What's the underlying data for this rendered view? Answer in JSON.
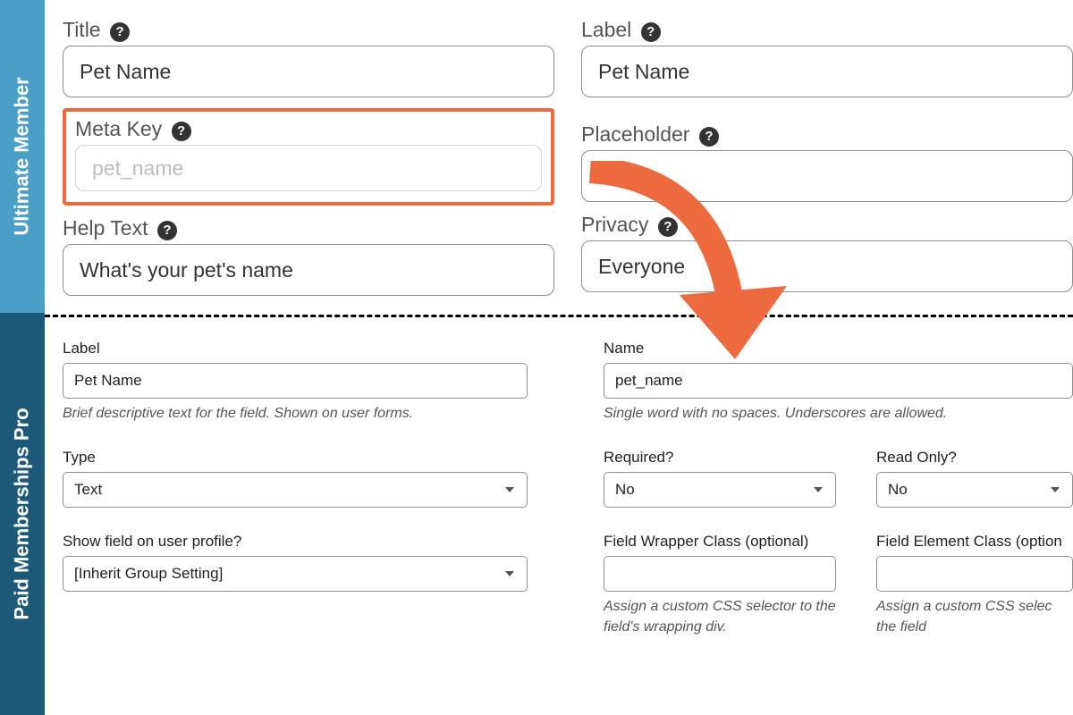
{
  "sidebar": {
    "top": "Ultimate Member",
    "bottom": "Paid Memberships Pro"
  },
  "um": {
    "title": {
      "label": "Title",
      "value": "Pet Name"
    },
    "metaKey": {
      "label": "Meta Key",
      "placeholder": "pet_name"
    },
    "helpText": {
      "label": "Help Text",
      "value": "What's your pet's name"
    },
    "labelField": {
      "label": "Label",
      "value": "Pet Name"
    },
    "placeholder": {
      "label": "Placeholder",
      "value": ""
    },
    "privacy": {
      "label": "Privacy",
      "value": "Everyone"
    }
  },
  "pm": {
    "labelField": {
      "label": "Label",
      "value": "Pet Name",
      "desc": "Brief descriptive text for the field. Shown on user forms."
    },
    "name": {
      "label": "Name",
      "value": "pet_name",
      "desc": "Single word with no spaces. Underscores are allowed."
    },
    "type": {
      "label": "Type",
      "value": "Text"
    },
    "required": {
      "label": "Required?",
      "value": "No"
    },
    "readOnly": {
      "label": "Read Only?",
      "value": "No"
    },
    "showProfile": {
      "label": "Show field on user profile?",
      "value": "[Inherit Group Setting]"
    },
    "wrapperClass": {
      "label": "Field Wrapper Class (optional)",
      "value": "",
      "desc": "Assign a custom CSS selector to the field's wrapping div."
    },
    "elementClass": {
      "label": "Field Element Class (option",
      "value": "",
      "desc": "Assign a custom CSS selec\nthe field"
    }
  }
}
